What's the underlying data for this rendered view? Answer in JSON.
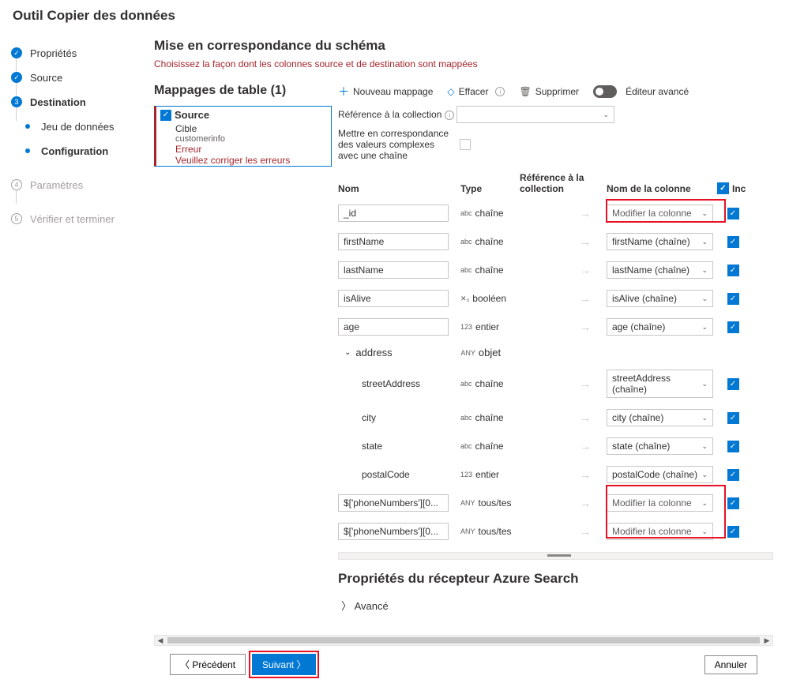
{
  "app_title": "Outil Copier des données",
  "steps": {
    "properties": "Propriétés",
    "source": "Source",
    "destination": "Destination",
    "dataset": "Jeu de données",
    "configuration": "Configuration",
    "parameters": "Paramètres",
    "param_num": "4",
    "verify": "Vérifier et terminer",
    "verify_num": "5",
    "dest_num": "3"
  },
  "page": {
    "title": "Mise en correspondance du schéma",
    "subtitle": "Choisissez la façon dont les colonnes source et de destination sont mappées"
  },
  "mappings_header": "Mappages de table (1)",
  "toolbar": {
    "new_mapping": "Nouveau mappage",
    "clear": "Effacer",
    "delete": "Supprimer",
    "advanced_editor": "Éditeur avancé"
  },
  "table_box": {
    "source": "Source",
    "target": "Cible",
    "customer": "customerinfo",
    "error": "Erreur",
    "error_msg": "Veuillez corriger les erreurs"
  },
  "collection": {
    "ref_label": "Référence à la collection",
    "complex_label": "Mettre en correspondance des valeurs complexes avec une chaîne"
  },
  "schema_head": {
    "name": "Nom",
    "type": "Type",
    "ref": "Référence à la collection",
    "colname": "Nom de la colonne",
    "inc": "Inc"
  },
  "type_names": {
    "string": "chaîne",
    "boolean": "booléen",
    "integer": "entier",
    "object": "objet",
    "any": "tous/tes"
  },
  "type_badges": {
    "abc": "abc",
    "bool": "✕₀",
    "int": "123",
    "any": "ANY"
  },
  "edit_placeholder": "Modifier la colonne",
  "rows": [
    {
      "name": "_id",
      "boxed": true,
      "badge": "abc",
      "type": "string",
      "col": null
    },
    {
      "name": "firstName",
      "boxed": true,
      "badge": "abc",
      "type": "string",
      "col": "firstName (chaîne)"
    },
    {
      "name": "lastName",
      "boxed": true,
      "badge": "abc",
      "type": "string",
      "col": "lastName (chaîne)"
    },
    {
      "name": "isAlive",
      "boxed": true,
      "badge": "bool",
      "type": "boolean",
      "col": "isAlive (chaîne)"
    },
    {
      "name": "age",
      "boxed": true,
      "badge": "int",
      "type": "integer",
      "col": "age (chaîne)"
    }
  ],
  "address_label": "address",
  "address_rows": [
    {
      "name": "streetAddress",
      "badge": "abc",
      "type": "string",
      "col": "streetAddress (chaîne)"
    },
    {
      "name": "city",
      "badge": "abc",
      "type": "string",
      "col": "city (chaîne)"
    },
    {
      "name": "state",
      "badge": "abc",
      "type": "string",
      "col": "state (chaîne)"
    },
    {
      "name": "postalCode",
      "badge": "int",
      "type": "integer",
      "col": "postalCode (chaîne)"
    }
  ],
  "phone_rows": [
    {
      "name": "$['phoneNumbers'][0...",
      "badge": "any",
      "type": "any",
      "col": null
    },
    {
      "name": "$['phoneNumbers'][0...",
      "badge": "any",
      "type": "any",
      "col": null
    }
  ],
  "receiver_title": "Propriétés du récepteur Azure Search",
  "advanced": "Avancé",
  "footer": {
    "prev": "Précédent",
    "next": "Suivant",
    "cancel": "Annuler"
  }
}
